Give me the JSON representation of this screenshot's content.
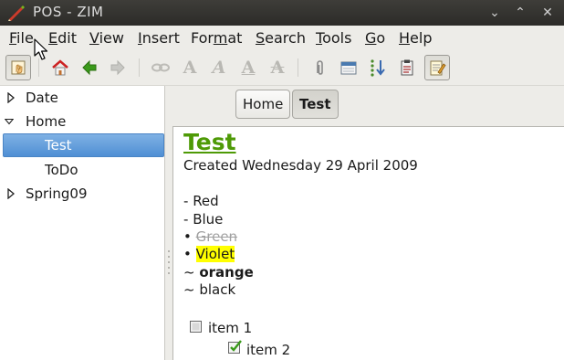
{
  "window": {
    "title": "POS - ZIM",
    "minimize_glyph": "⌄",
    "maximize_glyph": "⌃",
    "close_glyph": "✕"
  },
  "menu": [
    {
      "label": "File",
      "underline": "F",
      "rest": "ile"
    },
    {
      "label": "Edit",
      "underline": "E",
      "rest": "dit"
    },
    {
      "label": "View",
      "underline": "V",
      "rest": "iew"
    },
    {
      "label": "Insert",
      "underline": "I",
      "rest": "nsert"
    },
    {
      "label": "Format",
      "pre": "For",
      "underline": "m",
      "rest": "at"
    },
    {
      "label": "Search",
      "underline": "S",
      "rest": "earch"
    },
    {
      "label": "Tools",
      "underline": "T",
      "rest": "ools"
    },
    {
      "label": "Go",
      "underline": "G",
      "rest": "o"
    },
    {
      "label": "Help",
      "underline": "H",
      "rest": "elp"
    }
  ],
  "toolbar": {
    "icons": [
      "edit-mode-icon",
      "home-icon",
      "back-icon",
      "forward-icon",
      "link-icon",
      "bold-icon",
      "italic-icon",
      "underline-icon",
      "strike-icon",
      "attach-icon",
      "calendar-icon",
      "sort-icon",
      "clipboard-icon",
      "notebook-edit-icon"
    ],
    "format_letters": {
      "bold": "A",
      "italic": "A",
      "underline": "A",
      "strike": "A"
    }
  },
  "sidebar": {
    "items": [
      {
        "label": "Date",
        "expander": "collapsed"
      },
      {
        "label": "Home",
        "expander": "expanded"
      },
      {
        "label": "Test",
        "selected": true
      },
      {
        "label": "ToDo"
      },
      {
        "label": "Spring09",
        "expander": "collapsed"
      }
    ]
  },
  "pathbar": {
    "buttons": [
      {
        "label": "Home",
        "active": false
      },
      {
        "label": "Test",
        "active": true
      }
    ]
  },
  "page": {
    "title": "Test",
    "created": "Created Wednesday 29 April 2009",
    "lines": [
      {
        "prefix": "- ",
        "text": "Red"
      },
      {
        "prefix": "- ",
        "text": "Blue"
      },
      {
        "prefix": "• ",
        "text": "Green"
      },
      {
        "prefix": "• ",
        "text": "Violet"
      },
      {
        "prefix": "~ ",
        "text": "orange"
      },
      {
        "prefix": "~ ",
        "text": "black"
      }
    ],
    "checklist": [
      {
        "label": "item 1",
        "checked": false
      },
      {
        "label": "item 2",
        "checked": true
      }
    ]
  },
  "colors": {
    "heading": "#4e9a06",
    "highlight": "#ffff00",
    "selection": "#4f8fd4"
  }
}
